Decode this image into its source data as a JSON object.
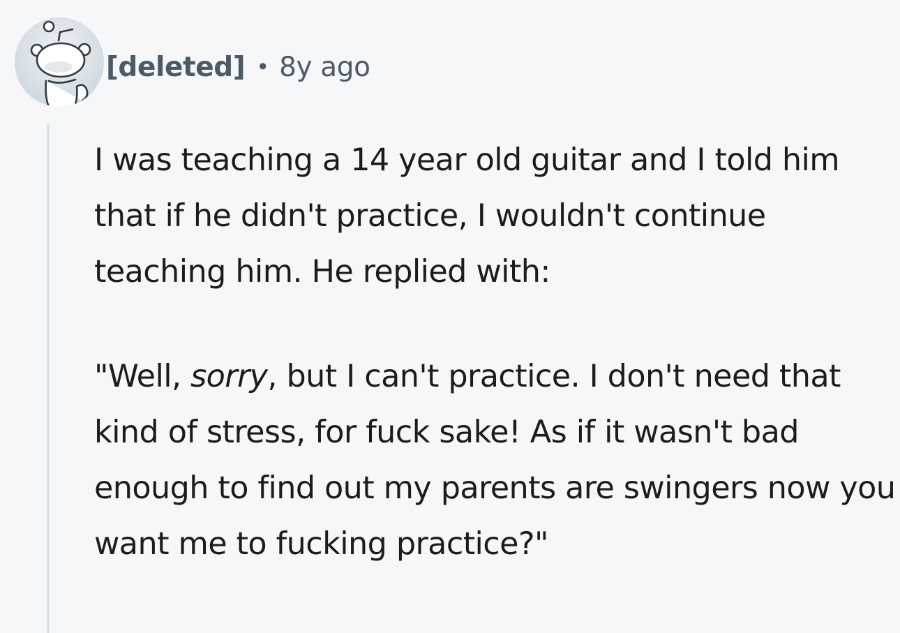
{
  "comment": {
    "avatar": {
      "icon": "reddit-snoo-avatar-icon",
      "background": "#d7dee5"
    },
    "author": "[deleted]",
    "separator": "•",
    "timestamp": "8y ago",
    "body": {
      "paragraph1": "I was teaching a 14 year old guitar and I told him that if he didn't practice, I wouldn't continue teaching him. He replied with:",
      "paragraph2": {
        "before": "\"Well, ",
        "emphasis": "sorry",
        "after": ", but I can't practice. I don't need that kind of stress, for fuck sake! As if it wasn't bad enough to find out my parents are swingers now you want me to fucking practice?\""
      }
    }
  },
  "colors": {
    "page_background": "#f6f7f8",
    "meta_text": "#4c5a68",
    "body_text": "#1c1c1c",
    "thread_line": "#dbe0e6"
  }
}
